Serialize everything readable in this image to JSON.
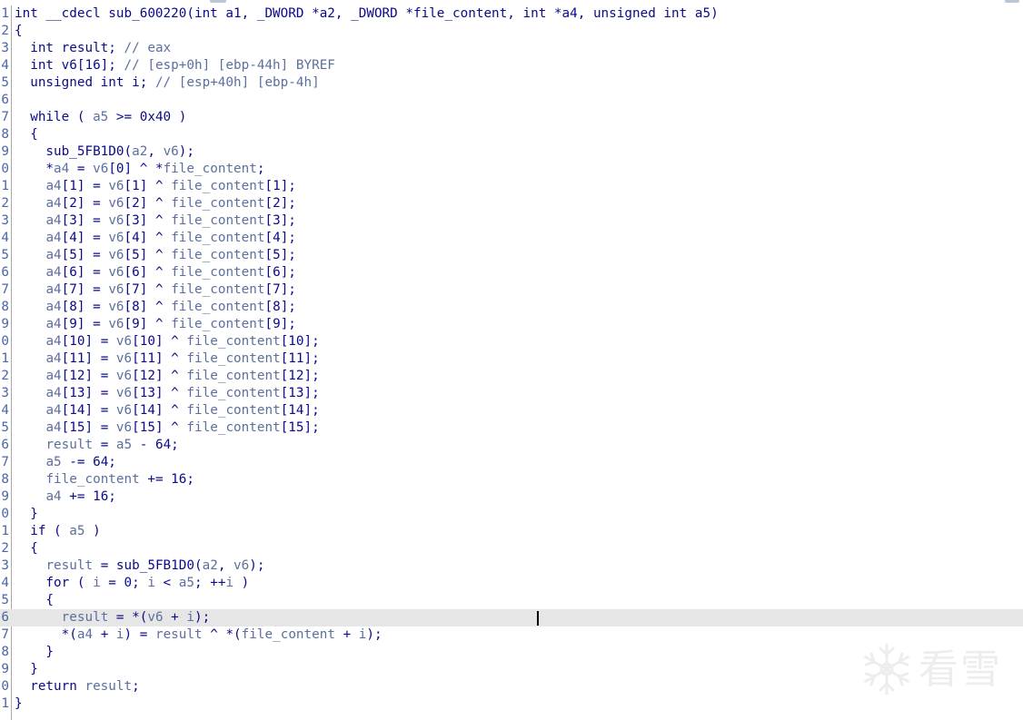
{
  "editor": {
    "current_line": 35,
    "lines": [
      {
        "n": "1",
        "segments": [
          [
            "k",
            "int __cdecl sub_600220(int a1, _DWORD *a2, _DWORD *file_content, int *a4, unsigned int a5)"
          ]
        ]
      },
      {
        "n": "2",
        "segments": [
          [
            "k",
            "{"
          ]
        ]
      },
      {
        "n": "3",
        "segments": [
          [
            "k",
            "  int result; "
          ],
          [
            "v",
            "// eax"
          ]
        ]
      },
      {
        "n": "4",
        "segments": [
          [
            "k",
            "  int v6[16]; "
          ],
          [
            "v",
            "// [esp+0h] [ebp-44h] BYREF"
          ]
        ]
      },
      {
        "n": "5",
        "segments": [
          [
            "k",
            "  unsigned int i; "
          ],
          [
            "v",
            "// [esp+40h] [ebp-4h]"
          ]
        ]
      },
      {
        "n": "6",
        "segments": [
          [
            "k",
            ""
          ]
        ]
      },
      {
        "n": "7",
        "segments": [
          [
            "k",
            "  while ( "
          ],
          [
            "v",
            "a5"
          ],
          [
            "k",
            " >= 0x40 )"
          ]
        ]
      },
      {
        "n": "8",
        "segments": [
          [
            "k",
            "  {"
          ]
        ]
      },
      {
        "n": "9",
        "segments": [
          [
            "k",
            "    sub_5FB1D0("
          ],
          [
            "v",
            "a2"
          ],
          [
            "k",
            ", "
          ],
          [
            "v",
            "v6"
          ],
          [
            "k",
            ");"
          ]
        ]
      },
      {
        "n": "0",
        "segments": [
          [
            "k",
            "    *"
          ],
          [
            "v",
            "a4"
          ],
          [
            "k",
            " = "
          ],
          [
            "v",
            "v6"
          ],
          [
            "k",
            "[0] ^ *"
          ],
          [
            "v",
            "file_content"
          ],
          [
            "k",
            ";"
          ]
        ]
      },
      {
        "n": "1",
        "segments": [
          [
            "k",
            "    "
          ],
          [
            "v",
            "a4"
          ],
          [
            "k",
            "[1] = "
          ],
          [
            "v",
            "v6"
          ],
          [
            "k",
            "[1] ^ "
          ],
          [
            "v",
            "file_content"
          ],
          [
            "k",
            "[1];"
          ]
        ]
      },
      {
        "n": "2",
        "segments": [
          [
            "k",
            "    "
          ],
          [
            "v",
            "a4"
          ],
          [
            "k",
            "[2] = "
          ],
          [
            "v",
            "v6"
          ],
          [
            "k",
            "[2] ^ "
          ],
          [
            "v",
            "file_content"
          ],
          [
            "k",
            "[2];"
          ]
        ]
      },
      {
        "n": "3",
        "segments": [
          [
            "k",
            "    "
          ],
          [
            "v",
            "a4"
          ],
          [
            "k",
            "[3] = "
          ],
          [
            "v",
            "v6"
          ],
          [
            "k",
            "[3] ^ "
          ],
          [
            "v",
            "file_content"
          ],
          [
            "k",
            "[3];"
          ]
        ]
      },
      {
        "n": "4",
        "segments": [
          [
            "k",
            "    "
          ],
          [
            "v",
            "a4"
          ],
          [
            "k",
            "[4] = "
          ],
          [
            "v",
            "v6"
          ],
          [
            "k",
            "[4] ^ "
          ],
          [
            "v",
            "file_content"
          ],
          [
            "k",
            "[4];"
          ]
        ]
      },
      {
        "n": "5",
        "segments": [
          [
            "k",
            "    "
          ],
          [
            "v",
            "a4"
          ],
          [
            "k",
            "[5] = "
          ],
          [
            "v",
            "v6"
          ],
          [
            "k",
            "[5] ^ "
          ],
          [
            "v",
            "file_content"
          ],
          [
            "k",
            "[5];"
          ]
        ]
      },
      {
        "n": "6",
        "segments": [
          [
            "k",
            "    "
          ],
          [
            "v",
            "a4"
          ],
          [
            "k",
            "[6] = "
          ],
          [
            "v",
            "v6"
          ],
          [
            "k",
            "[6] ^ "
          ],
          [
            "v",
            "file_content"
          ],
          [
            "k",
            "[6];"
          ]
        ]
      },
      {
        "n": "7",
        "segments": [
          [
            "k",
            "    "
          ],
          [
            "v",
            "a4"
          ],
          [
            "k",
            "[7] = "
          ],
          [
            "v",
            "v6"
          ],
          [
            "k",
            "[7] ^ "
          ],
          [
            "v",
            "file_content"
          ],
          [
            "k",
            "[7];"
          ]
        ]
      },
      {
        "n": "8",
        "segments": [
          [
            "k",
            "    "
          ],
          [
            "v",
            "a4"
          ],
          [
            "k",
            "[8] = "
          ],
          [
            "v",
            "v6"
          ],
          [
            "k",
            "[8] ^ "
          ],
          [
            "v",
            "file_content"
          ],
          [
            "k",
            "[8];"
          ]
        ]
      },
      {
        "n": "9",
        "segments": [
          [
            "k",
            "    "
          ],
          [
            "v",
            "a4"
          ],
          [
            "k",
            "[9] = "
          ],
          [
            "v",
            "v6"
          ],
          [
            "k",
            "[9] ^ "
          ],
          [
            "v",
            "file_content"
          ],
          [
            "k",
            "[9];"
          ]
        ]
      },
      {
        "n": "0",
        "segments": [
          [
            "k",
            "    "
          ],
          [
            "v",
            "a4"
          ],
          [
            "k",
            "[10] = "
          ],
          [
            "v",
            "v6"
          ],
          [
            "k",
            "[10] ^ "
          ],
          [
            "v",
            "file_content"
          ],
          [
            "k",
            "[10];"
          ]
        ]
      },
      {
        "n": "1",
        "segments": [
          [
            "k",
            "    "
          ],
          [
            "v",
            "a4"
          ],
          [
            "k",
            "[11] = "
          ],
          [
            "v",
            "v6"
          ],
          [
            "k",
            "[11] ^ "
          ],
          [
            "v",
            "file_content"
          ],
          [
            "k",
            "[11];"
          ]
        ]
      },
      {
        "n": "2",
        "segments": [
          [
            "k",
            "    "
          ],
          [
            "v",
            "a4"
          ],
          [
            "k",
            "[12] = "
          ],
          [
            "v",
            "v6"
          ],
          [
            "k",
            "[12] ^ "
          ],
          [
            "v",
            "file_content"
          ],
          [
            "k",
            "[12];"
          ]
        ]
      },
      {
        "n": "3",
        "segments": [
          [
            "k",
            "    "
          ],
          [
            "v",
            "a4"
          ],
          [
            "k",
            "[13] = "
          ],
          [
            "v",
            "v6"
          ],
          [
            "k",
            "[13] ^ "
          ],
          [
            "v",
            "file_content"
          ],
          [
            "k",
            "[13];"
          ]
        ]
      },
      {
        "n": "4",
        "segments": [
          [
            "k",
            "    "
          ],
          [
            "v",
            "a4"
          ],
          [
            "k",
            "[14] = "
          ],
          [
            "v",
            "v6"
          ],
          [
            "k",
            "[14] ^ "
          ],
          [
            "v",
            "file_content"
          ],
          [
            "k",
            "[14];"
          ]
        ]
      },
      {
        "n": "5",
        "segments": [
          [
            "k",
            "    "
          ],
          [
            "v",
            "a4"
          ],
          [
            "k",
            "[15] = "
          ],
          [
            "v",
            "v6"
          ],
          [
            "k",
            "[15] ^ "
          ],
          [
            "v",
            "file_content"
          ],
          [
            "k",
            "[15];"
          ]
        ]
      },
      {
        "n": "6",
        "segments": [
          [
            "k",
            "    "
          ],
          [
            "v",
            "result"
          ],
          [
            "k",
            " = "
          ],
          [
            "v",
            "a5"
          ],
          [
            "k",
            " - 64;"
          ]
        ]
      },
      {
        "n": "7",
        "segments": [
          [
            "k",
            "    "
          ],
          [
            "v",
            "a5"
          ],
          [
            "k",
            " -= 64;"
          ]
        ]
      },
      {
        "n": "8",
        "segments": [
          [
            "k",
            "    "
          ],
          [
            "v",
            "file_content"
          ],
          [
            "k",
            " += 16;"
          ]
        ]
      },
      {
        "n": "9",
        "segments": [
          [
            "k",
            "    "
          ],
          [
            "v",
            "a4"
          ],
          [
            "k",
            " += 16;"
          ]
        ]
      },
      {
        "n": "0",
        "segments": [
          [
            "k",
            "  }"
          ]
        ]
      },
      {
        "n": "1",
        "segments": [
          [
            "k",
            "  if ( "
          ],
          [
            "v",
            "a5"
          ],
          [
            "k",
            " )"
          ]
        ]
      },
      {
        "n": "2",
        "segments": [
          [
            "k",
            "  {"
          ]
        ]
      },
      {
        "n": "3",
        "segments": [
          [
            "k",
            "    "
          ],
          [
            "v",
            "result"
          ],
          [
            "k",
            " = sub_5FB1D0("
          ],
          [
            "v",
            "a2"
          ],
          [
            "k",
            ", "
          ],
          [
            "v",
            "v6"
          ],
          [
            "k",
            ");"
          ]
        ]
      },
      {
        "n": "4",
        "segments": [
          [
            "k",
            "    for ( "
          ],
          [
            "v",
            "i"
          ],
          [
            "k",
            " = 0; "
          ],
          [
            "v",
            "i"
          ],
          [
            "k",
            " < "
          ],
          [
            "v",
            "a5"
          ],
          [
            "k",
            "; ++"
          ],
          [
            "v",
            "i"
          ],
          [
            "k",
            " )"
          ]
        ]
      },
      {
        "n": "5",
        "segments": [
          [
            "k",
            "    {"
          ]
        ]
      },
      {
        "n": "6",
        "segments": [
          [
            "k",
            "      "
          ],
          [
            "v",
            "result"
          ],
          [
            "k",
            " = *("
          ],
          [
            "v",
            "v6"
          ],
          [
            "k",
            " + "
          ],
          [
            "v",
            "i"
          ],
          [
            "k",
            ");"
          ]
        ]
      },
      {
        "n": "7",
        "segments": [
          [
            "k",
            "      *("
          ],
          [
            "v",
            "a4"
          ],
          [
            "k",
            " + "
          ],
          [
            "v",
            "i"
          ],
          [
            "k",
            ") = "
          ],
          [
            "v",
            "result"
          ],
          [
            "k",
            " ^ *("
          ],
          [
            "v",
            "file_content"
          ],
          [
            "k",
            " + "
          ],
          [
            "v",
            "i"
          ],
          [
            "k",
            ");"
          ]
        ]
      },
      {
        "n": "8",
        "segments": [
          [
            "k",
            "    }"
          ]
        ]
      },
      {
        "n": "9",
        "segments": [
          [
            "k",
            "  }"
          ]
        ]
      },
      {
        "n": "0",
        "segments": [
          [
            "k",
            "  return "
          ],
          [
            "v",
            "result"
          ],
          [
            "k",
            ";"
          ]
        ]
      },
      {
        "n": "1",
        "segments": [
          [
            "k",
            "}"
          ]
        ]
      }
    ]
  },
  "watermark": {
    "text": "看雪",
    "icon": "snowflake-icon"
  },
  "colors": {
    "keyword": "#0a0a8a",
    "variable": "#5c6f9e",
    "line_number": "#4a66a8",
    "current_line_bg": "#e6e6e6"
  }
}
